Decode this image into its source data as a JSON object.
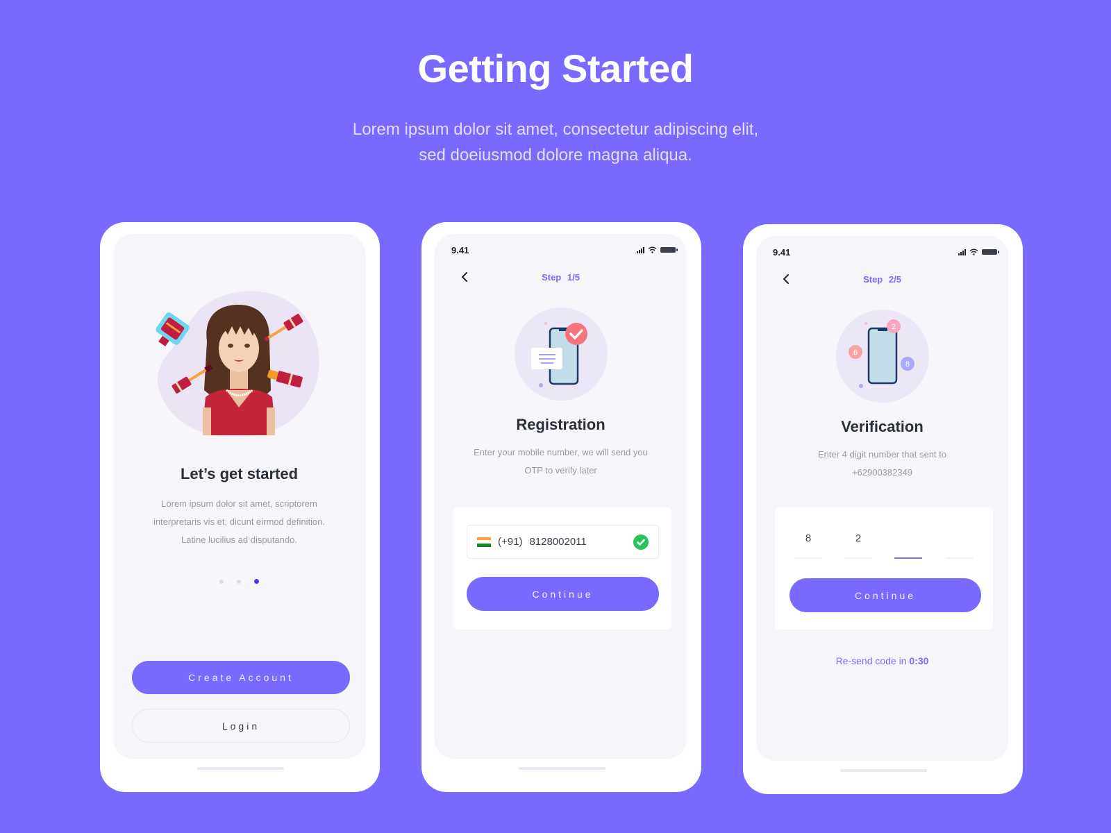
{
  "header": {
    "title": "Getting Started",
    "subtitle_line1": "Lorem ipsum dolor sit amet, consectetur adipiscing elit,",
    "subtitle_line2": "sed doeiusmod dolore magna aliqua."
  },
  "colors": {
    "background": "#7a69fe",
    "accent": "#7a69fe",
    "screen": "#f6f5fa",
    "success": "#27c45c",
    "pagination_active": "#4a37f5"
  },
  "screen1": {
    "illustration": "woman-with-cosmetics-illustration",
    "title": "Let’s get started",
    "desc_line1": "Lorem ipsum dolor sit amet, scriptorem",
    "desc_line2": "interpretaris vis et, dicunt eirmod definition.",
    "desc_line3": "Latine lucilius ad disputando.",
    "pagination": {
      "total": 3,
      "active": 3
    },
    "create_account_label": "Create Account",
    "login_label": "Login"
  },
  "screen2": {
    "status_time": "9.41",
    "step_label": "Step",
    "step_value": "1/5",
    "illustration": "phone-message-check-illustration",
    "title": "Registration",
    "desc_line1": "Enter your mobile number, we will send you",
    "desc_line2": "OTP to verify later",
    "country_flag": "india-flag-icon",
    "country_code": "(+91)",
    "phone_number": "8128002011",
    "continue_label": "Continue"
  },
  "screen3": {
    "status_time": "9.41",
    "step_label": "Step",
    "step_value": "2/5",
    "illustration": "phone-otp-digits-illustration",
    "illus_badges": [
      "2",
      "6",
      "8"
    ],
    "title": "Verification",
    "desc_line1": "Enter 4 digit number that sent to",
    "desc_line2": "+62900382349",
    "otp_digits": [
      "8",
      "2",
      "",
      ""
    ],
    "active_otp_index": 2,
    "continue_label": "Continue",
    "resend_prefix": "Re-send code in",
    "resend_timer": "0:30"
  }
}
